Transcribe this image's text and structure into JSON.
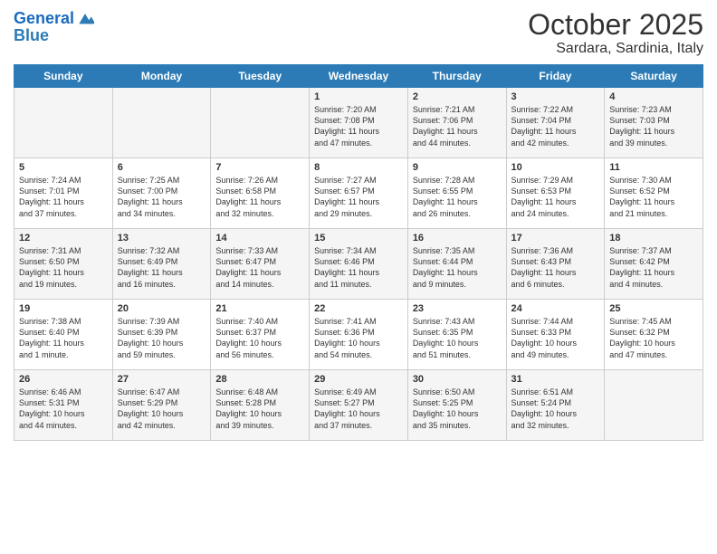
{
  "logo": {
    "line1": "General",
    "line2": "Blue"
  },
  "title": "October 2025",
  "subtitle": "Sardara, Sardinia, Italy",
  "days_of_week": [
    "Sunday",
    "Monday",
    "Tuesday",
    "Wednesday",
    "Thursday",
    "Friday",
    "Saturday"
  ],
  "weeks": [
    [
      {
        "day": "",
        "info": ""
      },
      {
        "day": "",
        "info": ""
      },
      {
        "day": "",
        "info": ""
      },
      {
        "day": "1",
        "info": "Sunrise: 7:20 AM\nSunset: 7:08 PM\nDaylight: 11 hours\nand 47 minutes."
      },
      {
        "day": "2",
        "info": "Sunrise: 7:21 AM\nSunset: 7:06 PM\nDaylight: 11 hours\nand 44 minutes."
      },
      {
        "day": "3",
        "info": "Sunrise: 7:22 AM\nSunset: 7:04 PM\nDaylight: 11 hours\nand 42 minutes."
      },
      {
        "day": "4",
        "info": "Sunrise: 7:23 AM\nSunset: 7:03 PM\nDaylight: 11 hours\nand 39 minutes."
      }
    ],
    [
      {
        "day": "5",
        "info": "Sunrise: 7:24 AM\nSunset: 7:01 PM\nDaylight: 11 hours\nand 37 minutes."
      },
      {
        "day": "6",
        "info": "Sunrise: 7:25 AM\nSunset: 7:00 PM\nDaylight: 11 hours\nand 34 minutes."
      },
      {
        "day": "7",
        "info": "Sunrise: 7:26 AM\nSunset: 6:58 PM\nDaylight: 11 hours\nand 32 minutes."
      },
      {
        "day": "8",
        "info": "Sunrise: 7:27 AM\nSunset: 6:57 PM\nDaylight: 11 hours\nand 29 minutes."
      },
      {
        "day": "9",
        "info": "Sunrise: 7:28 AM\nSunset: 6:55 PM\nDaylight: 11 hours\nand 26 minutes."
      },
      {
        "day": "10",
        "info": "Sunrise: 7:29 AM\nSunset: 6:53 PM\nDaylight: 11 hours\nand 24 minutes."
      },
      {
        "day": "11",
        "info": "Sunrise: 7:30 AM\nSunset: 6:52 PM\nDaylight: 11 hours\nand 21 minutes."
      }
    ],
    [
      {
        "day": "12",
        "info": "Sunrise: 7:31 AM\nSunset: 6:50 PM\nDaylight: 11 hours\nand 19 minutes."
      },
      {
        "day": "13",
        "info": "Sunrise: 7:32 AM\nSunset: 6:49 PM\nDaylight: 11 hours\nand 16 minutes."
      },
      {
        "day": "14",
        "info": "Sunrise: 7:33 AM\nSunset: 6:47 PM\nDaylight: 11 hours\nand 14 minutes."
      },
      {
        "day": "15",
        "info": "Sunrise: 7:34 AM\nSunset: 6:46 PM\nDaylight: 11 hours\nand 11 minutes."
      },
      {
        "day": "16",
        "info": "Sunrise: 7:35 AM\nSunset: 6:44 PM\nDaylight: 11 hours\nand 9 minutes."
      },
      {
        "day": "17",
        "info": "Sunrise: 7:36 AM\nSunset: 6:43 PM\nDaylight: 11 hours\nand 6 minutes."
      },
      {
        "day": "18",
        "info": "Sunrise: 7:37 AM\nSunset: 6:42 PM\nDaylight: 11 hours\nand 4 minutes."
      }
    ],
    [
      {
        "day": "19",
        "info": "Sunrise: 7:38 AM\nSunset: 6:40 PM\nDaylight: 11 hours\nand 1 minute."
      },
      {
        "day": "20",
        "info": "Sunrise: 7:39 AM\nSunset: 6:39 PM\nDaylight: 10 hours\nand 59 minutes."
      },
      {
        "day": "21",
        "info": "Sunrise: 7:40 AM\nSunset: 6:37 PM\nDaylight: 10 hours\nand 56 minutes."
      },
      {
        "day": "22",
        "info": "Sunrise: 7:41 AM\nSunset: 6:36 PM\nDaylight: 10 hours\nand 54 minutes."
      },
      {
        "day": "23",
        "info": "Sunrise: 7:43 AM\nSunset: 6:35 PM\nDaylight: 10 hours\nand 51 minutes."
      },
      {
        "day": "24",
        "info": "Sunrise: 7:44 AM\nSunset: 6:33 PM\nDaylight: 10 hours\nand 49 minutes."
      },
      {
        "day": "25",
        "info": "Sunrise: 7:45 AM\nSunset: 6:32 PM\nDaylight: 10 hours\nand 47 minutes."
      }
    ],
    [
      {
        "day": "26",
        "info": "Sunrise: 6:46 AM\nSunset: 5:31 PM\nDaylight: 10 hours\nand 44 minutes."
      },
      {
        "day": "27",
        "info": "Sunrise: 6:47 AM\nSunset: 5:29 PM\nDaylight: 10 hours\nand 42 minutes."
      },
      {
        "day": "28",
        "info": "Sunrise: 6:48 AM\nSunset: 5:28 PM\nDaylight: 10 hours\nand 39 minutes."
      },
      {
        "day": "29",
        "info": "Sunrise: 6:49 AM\nSunset: 5:27 PM\nDaylight: 10 hours\nand 37 minutes."
      },
      {
        "day": "30",
        "info": "Sunrise: 6:50 AM\nSunset: 5:25 PM\nDaylight: 10 hours\nand 35 minutes."
      },
      {
        "day": "31",
        "info": "Sunrise: 6:51 AM\nSunset: 5:24 PM\nDaylight: 10 hours\nand 32 minutes."
      },
      {
        "day": "",
        "info": ""
      }
    ]
  ]
}
